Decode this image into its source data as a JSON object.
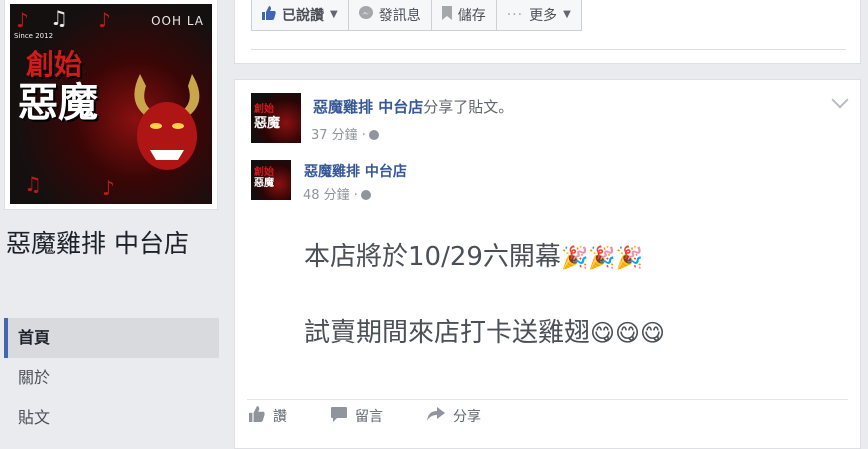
{
  "cover": {
    "ooh": "OOH LA",
    "since": "Since 2012",
    "brand_small": "創始",
    "brand_big": "惡魔"
  },
  "page": {
    "name": "惡魔雞排 中台店"
  },
  "nav": {
    "items": [
      {
        "label": "首頁",
        "active": true
      },
      {
        "label": "關於",
        "active": false
      },
      {
        "label": "貼文",
        "active": false
      }
    ]
  },
  "top_actions": {
    "liked": "已說讚",
    "message": "發訊息",
    "save": "儲存",
    "more": "更多"
  },
  "post": {
    "author": "惡魔雞排 中台店",
    "action_text": "分享了貼文。",
    "time": "37 分鐘 ·",
    "shared_author": "惡魔雞排 中台店",
    "shared_time": "48 分鐘 ·",
    "line1": "本店將於10/29六開幕",
    "line1_emoji": "🎉🎉🎉",
    "line2": "試賣期間來店打卡送雞翅",
    "line2_emoji": "😋😋😋"
  },
  "post_actions": {
    "like": "讚",
    "comment": "留言",
    "share": "分享"
  },
  "colors": {
    "link": "#365899",
    "accent": "#4267b2",
    "background": "#e9ebee"
  }
}
